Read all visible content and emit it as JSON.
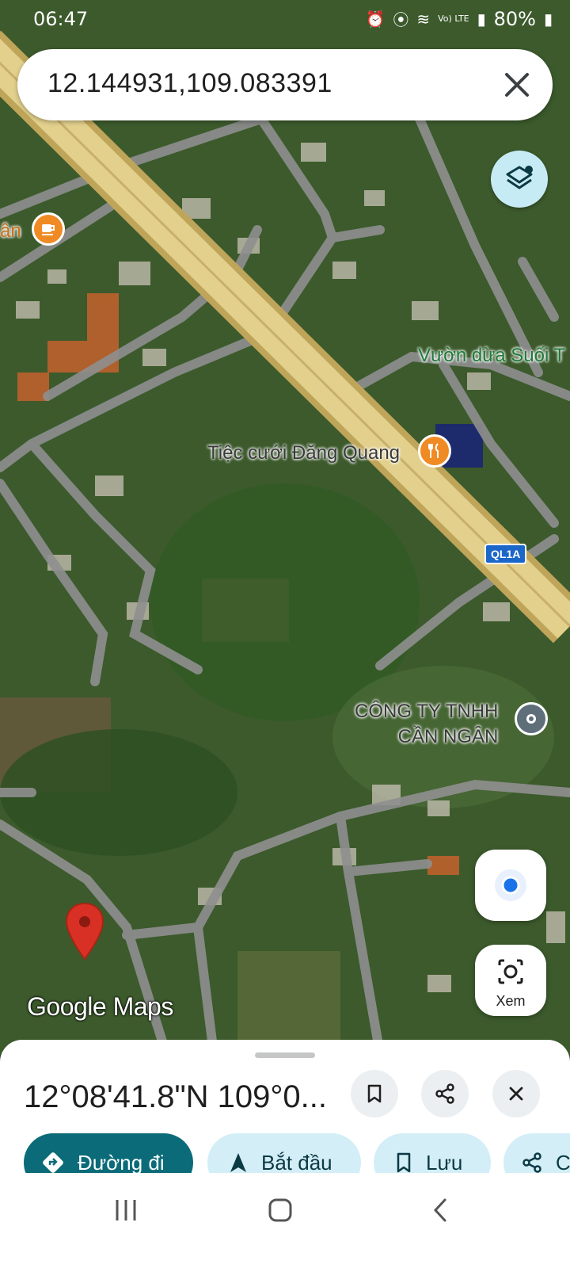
{
  "status_bar": {
    "time": "06:47",
    "battery": "80%",
    "network": "Vo) LTE"
  },
  "search": {
    "query": "12.144931,109.083391"
  },
  "map": {
    "labels": {
      "left_cut": "ân",
      "vuon_dua": "Vườn dừa Suối T",
      "tiec_cuoi": "Tiệc cưới Đăng Quang",
      "company_line1": "CÔNG TY TNHH",
      "company_line2": "CẦN NGÂN"
    },
    "road_shield": "QL1A",
    "view_button_label": "Xem",
    "logo": {
      "google": "Google",
      "maps": "Maps"
    },
    "colors": {
      "highway": "#d9c47a",
      "road": "#8a8a8a",
      "pin": "#d93025",
      "poi_food": "#f08a24"
    }
  },
  "sheet": {
    "title": "12°08'41.8\"N 109°0...",
    "chips": {
      "directions": "Đường đi",
      "start": "Bắt đầu",
      "save": "Lưu",
      "share": "C"
    }
  },
  "icons": {
    "clear": "close-icon",
    "layers": "layers-icon",
    "bookmark": "bookmark-icon",
    "share": "share-icon",
    "close": "close-icon",
    "recent_apps": "recent-apps-icon",
    "home": "home-icon",
    "back": "back-icon"
  }
}
